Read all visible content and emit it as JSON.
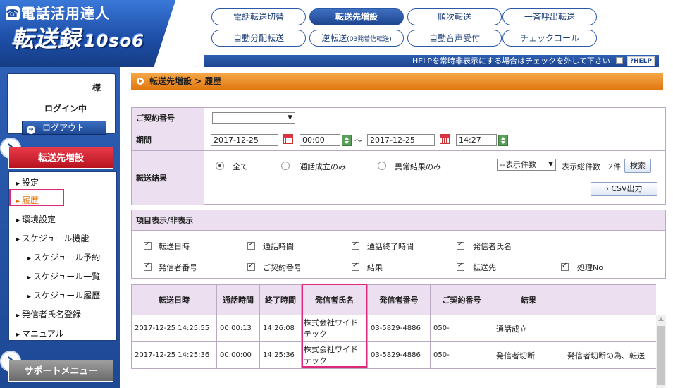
{
  "logo": {
    "top": "電話活用達人",
    "main": "転送録",
    "sub": "10so6"
  },
  "top_nav": [
    {
      "label": "電話転送切替"
    },
    {
      "label": "転送先増設"
    },
    {
      "label": "順次転送"
    },
    {
      "label": "一斉呼出転送"
    },
    {
      "label": "自動分配転送"
    },
    {
      "label": "逆転送",
      "small": "(03発着信転送)"
    },
    {
      "label": "自動音声受付"
    },
    {
      "label": "チェックコール"
    }
  ],
  "helpbar": {
    "text": "HELPを常時非表示にする場合はチェックを外して下さい",
    "button": "?HELP"
  },
  "sidebar": {
    "sama": "様",
    "login_status": "ログイン中",
    "logout": "ログアウト",
    "menu_title": "転送先増設",
    "items": [
      {
        "label": "設定"
      },
      {
        "label": "履歴"
      },
      {
        "label": "環境設定"
      },
      {
        "label": "スケジュール機能"
      },
      {
        "label": "スケジュール予約"
      },
      {
        "label": "スケジュール一覧"
      },
      {
        "label": "スケジュール履歴"
      },
      {
        "label": "発信者氏名登録"
      },
      {
        "label": "マニュアル"
      }
    ],
    "support_title": "サポートメニュー"
  },
  "breadcrumb": "転送先増設 > 履歴",
  "search": {
    "contract_label": "ご契約番号",
    "contract_value": "",
    "period_label": "期間",
    "date_from": "2017-12-25",
    "time_from": "00:00",
    "tilde": "～",
    "date_to": "2017-12-25",
    "time_to": "14:27",
    "result_label": "転送結果",
    "radios": [
      {
        "label": "全て"
      },
      {
        "label": "通話成立のみ"
      },
      {
        "label": "異常結果のみ"
      }
    ],
    "count_select": "--表示件数",
    "total_text": "表示総件数",
    "total_count": "2件",
    "search_button": "検索",
    "csv_button": "CSV出力"
  },
  "columns_panel": {
    "title": "項目表示/非表示",
    "checkboxes": [
      {
        "label": "転送日時"
      },
      {
        "label": "通話時間"
      },
      {
        "label": "通話終了時間"
      },
      {
        "label": "発信者氏名"
      },
      {
        "label": "発信者番号"
      },
      {
        "label": "ご契約番号"
      },
      {
        "label": "結果"
      },
      {
        "label": "転送先"
      },
      {
        "label": "処理No"
      }
    ]
  },
  "results": {
    "headers": [
      "転送日時",
      "通話時間",
      "終了時間",
      "発信者氏名",
      "発信者番号",
      "ご契約番号",
      "結果",
      ""
    ],
    "rows": [
      [
        "2017-12-25 14:25:55",
        "00:00:13",
        "14:26:08",
        "株式会社ワイドテック",
        "03-5829-4886",
        "050-",
        "通話成立",
        ""
      ],
      [
        "2017-12-25 14:25:36",
        "00:00:00",
        "14:25:36",
        "株式会社ワイドテック",
        "03-5829-4886",
        "050-",
        "発信者切断",
        "発信者切断の為、転送"
      ]
    ]
  }
}
